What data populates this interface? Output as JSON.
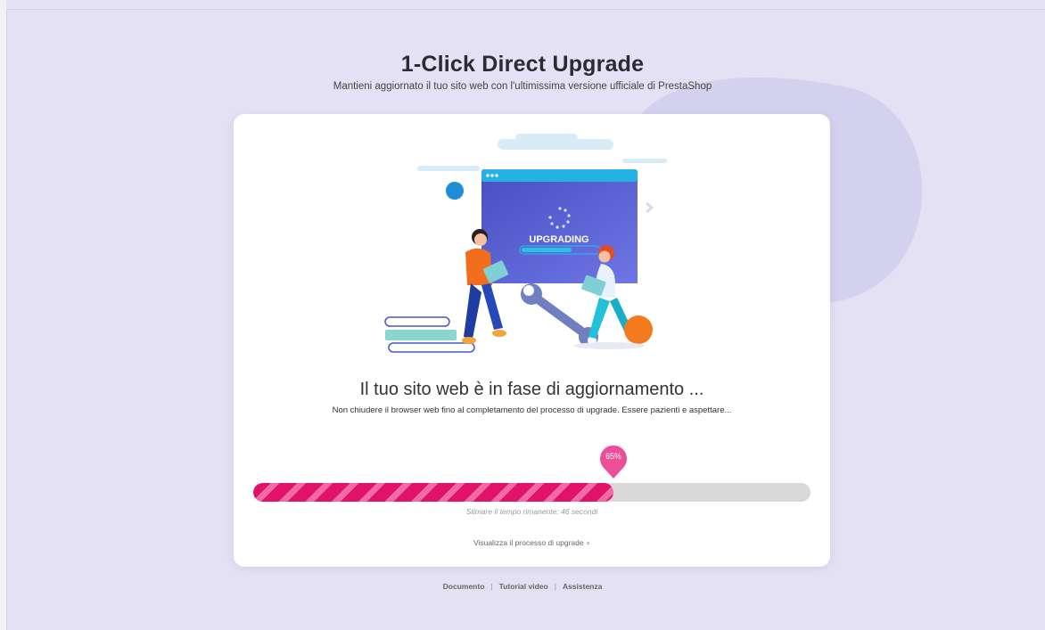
{
  "header": {
    "title": "1-Click Direct Upgrade",
    "subtitle": "Mantieni aggiornato il tuo sito web con l'ultimissima versione ufficiale di PrestaShop"
  },
  "illustration": {
    "screen_label": "UPGRADING"
  },
  "status": {
    "heading": "Il tuo sito web è in fase di aggiornamento ...",
    "description": "Non chiudere il browser web fino al completamento del processo di upgrade. Essere pazienti e aspettare..."
  },
  "progress": {
    "percent": 65,
    "label": "65%",
    "time_remaining": "Stimare il tempo rimanente: 46 secondi",
    "fill_color": "#e0126a",
    "track_color": "#d9d9d9"
  },
  "view_process": {
    "label": "Visualizza il processo di upgrade",
    "icon": "double-chevron-down-icon"
  },
  "footer": {
    "links": [
      "Documento",
      "Tutorial video",
      "Assistenza"
    ]
  },
  "colors": {
    "background": "#e4e2f3",
    "card": "#ffffff",
    "accent": "#e0126a"
  }
}
